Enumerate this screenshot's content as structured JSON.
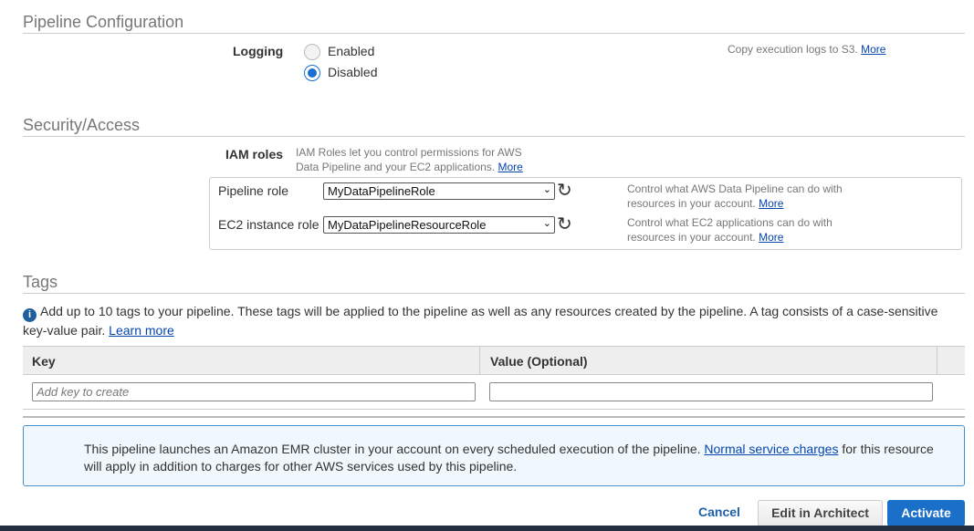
{
  "pipeline_config": {
    "title": "Pipeline Configuration",
    "logging_label": "Logging",
    "options": [
      "Enabled",
      "Disabled"
    ],
    "selected": "Disabled",
    "help": "Copy execution logs to S3.",
    "more": "More"
  },
  "security": {
    "title": "Security/Access",
    "iam_label": "IAM roles",
    "iam_help_1": "IAM Roles let you control permissions for AWS",
    "iam_help_2": "Data Pipeline and your EC2 applications.",
    "more": "More",
    "pipeline_role": {
      "label": "Pipeline role",
      "value": "MyDataPipelineRole",
      "help_1": "Control what AWS Data Pipeline can do with",
      "help_2": "resources in your account.",
      "more": "More"
    },
    "ec2_role": {
      "label": "EC2 instance role",
      "value": "MyDataPipelineResourceRole",
      "help_1": "Control what EC2 applications can do with",
      "help_2": "resources in your account.",
      "more": "More"
    }
  },
  "tags": {
    "title": "Tags",
    "info": "Add up to 10 tags to your pipeline. These tags will be applied to the pipeline as well as any resources created by the pipeline. A tag consists of a case-sensitive key-value pair.",
    "learn_more": "Learn more",
    "col_key": "Key",
    "col_value": "Value (Optional)",
    "key_placeholder": "Add key to create",
    "value_placeholder": ""
  },
  "notice": {
    "text_1": "This pipeline launches an Amazon EMR cluster in your account on every scheduled execution of the pipeline.",
    "link": "Normal service charges",
    "text_2": "for this resource will apply in addition to charges for other AWS services used by this pipeline."
  },
  "footer": {
    "cancel": "Cancel",
    "edit": "Edit in Architect",
    "activate": "Activate"
  }
}
